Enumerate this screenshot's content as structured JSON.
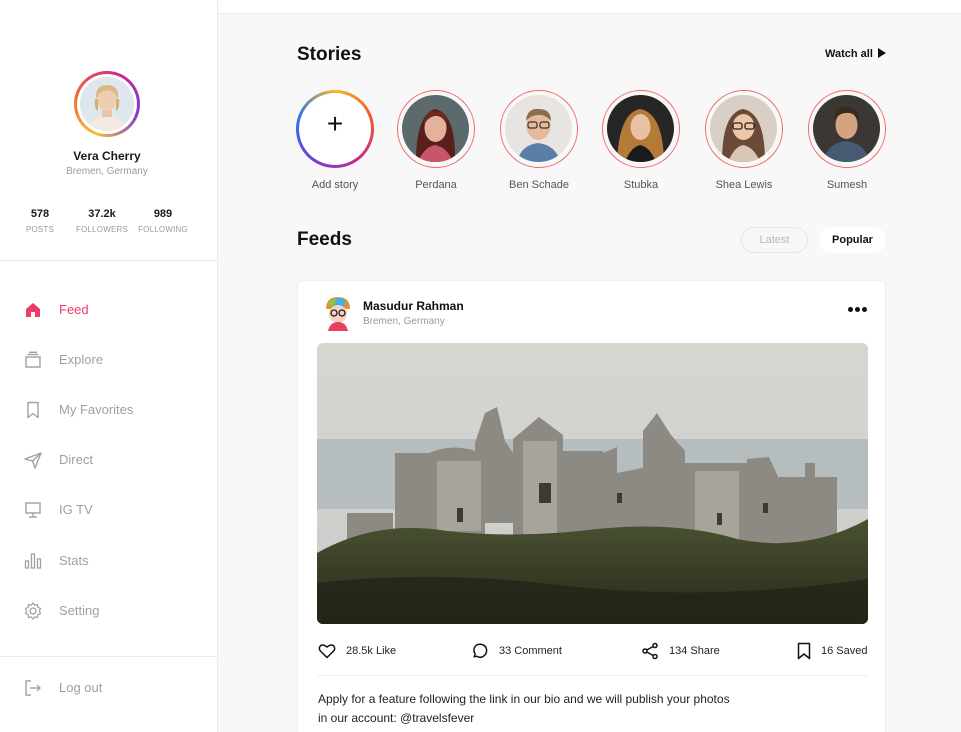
{
  "profile": {
    "name": "Vera Cherry",
    "location": "Bremen, Germany",
    "stats": [
      {
        "value": "578",
        "label": "POSTS"
      },
      {
        "value": "37.2k",
        "label": "FOLLOWERS"
      },
      {
        "value": "989",
        "label": "FOLLOWING"
      }
    ]
  },
  "nav": {
    "items": [
      {
        "label": "Feed",
        "icon": "home-icon",
        "active": true
      },
      {
        "label": "Explore",
        "icon": "explore-icon"
      },
      {
        "label": "My Favorites",
        "icon": "bookmark-icon"
      },
      {
        "label": "Direct",
        "icon": "send-icon"
      },
      {
        "label": "IG TV",
        "icon": "tv-icon"
      },
      {
        "label": "Stats",
        "icon": "bar-chart-icon"
      },
      {
        "label": "Setting",
        "icon": "gear-icon"
      }
    ],
    "logout": "Log out"
  },
  "stories": {
    "title": "Stories",
    "watch_all": "Watch all",
    "add_label": "Add story",
    "items": [
      "Perdana",
      "Ben Schade",
      "Stubka",
      "Shea Lewis",
      "Sumesh"
    ]
  },
  "feeds": {
    "title": "Feeds",
    "tabs": {
      "latest": "Latest",
      "popular": "Popular"
    }
  },
  "post": {
    "author": "Masudur Rahman",
    "location": "Bremen, Germany",
    "likes": "28.5k Like",
    "comments": "33 Comment",
    "shares": "134 Share",
    "saved": "16 Saved",
    "caption_line1": "Apply for a feature following the link in our bio and we will publish your photos",
    "caption_line2": "in our account: @travelsfever"
  },
  "colors": {
    "accent": "#ee3d62",
    "muted": "#a0a0a0"
  }
}
